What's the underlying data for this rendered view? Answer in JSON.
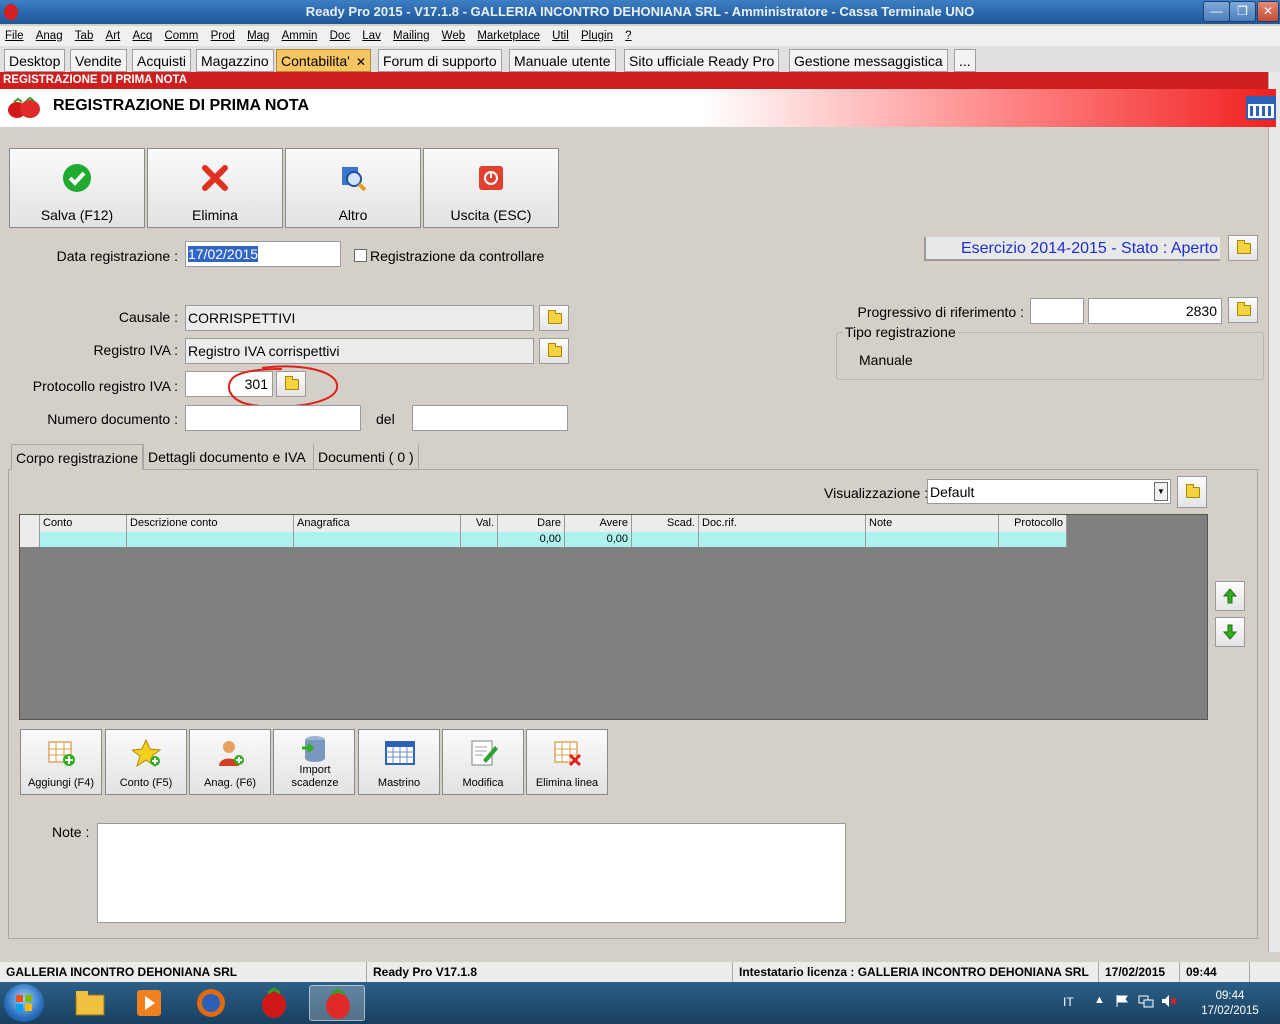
{
  "window": {
    "title": "Ready Pro 2015 - V17.1.8 - GALLERIA INCONTRO DEHONIANA SRL - Amministratore - Cassa Terminale UNO",
    "minimize": "—",
    "restore": "❐",
    "close": "✕"
  },
  "menu": [
    "File",
    "Anag",
    "Tab",
    "Art",
    "Acq",
    "Comm",
    "Prod",
    "Mag",
    "Ammin",
    "Doc",
    "Lav",
    "Mailing",
    "Web",
    "Marketplace",
    "Util",
    "Plugin",
    "?"
  ],
  "tabs": [
    {
      "label": "Desktop"
    },
    {
      "label": "Vendite"
    },
    {
      "label": "Acquisti"
    },
    {
      "label": "Magazzino"
    },
    {
      "label": "Contabilita'",
      "active": true,
      "close": "✕"
    },
    {
      "label": "Forum di supporto"
    },
    {
      "label": "Manuale utente"
    },
    {
      "label": "Sito ufficiale Ready Pro"
    },
    {
      "label": "Gestione messaggistica"
    },
    {
      "label": "..."
    }
  ],
  "form": {
    "caption": "REGISTRAZIONE DI PRIMA NOTA",
    "title": "REGISTRAZIONE DI PRIMA NOTA"
  },
  "toolbar": {
    "save": "Salva (F12)",
    "delete": "Elimina",
    "other": "Altro",
    "exit": "Uscita (ESC)"
  },
  "fields": {
    "data_label": "Data registrazione :",
    "data_value": "17/02/2015",
    "controllare_label": "Registrazione da controllare",
    "esercizio": "Esercizio 2014-2015 - Stato : Aperto",
    "causale_label": "Causale :",
    "causale_value": "CORRISPETTIVI",
    "registro_label": "Registro IVA :",
    "registro_value": "Registro IVA corrispettivi",
    "protocollo_label": "Protocollo registro IVA :",
    "protocollo_value": "301",
    "numero_label": "Numero documento :",
    "numero_value": "",
    "del_label": "del",
    "del_value": "",
    "progressivo_label": "Progressivo di riferimento :",
    "progressivo_a": "",
    "progressivo_b": "2830",
    "tipo_group": "Tipo registrazione",
    "tipo_value": "Manuale"
  },
  "inner_tabs": [
    "Corpo registrazione",
    "Dettagli documento e IVA",
    "Documenti ( 0 )"
  ],
  "view": {
    "label": "Visualizzazione :",
    "value": "Default"
  },
  "grid": {
    "columns": [
      "",
      "Conto",
      "Descrizione conto",
      "Anagrafica",
      "Val.",
      "Dare",
      "Avere",
      "Scad.",
      "Doc.rif.",
      "Note",
      "Protocollo"
    ],
    "rows": [
      [
        "",
        "",
        "",
        "",
        "",
        "0,00",
        "0,00",
        "",
        "",
        "",
        ""
      ]
    ]
  },
  "actions": [
    {
      "label": "Aggiungi (F4)"
    },
    {
      "label": "Conto (F5)"
    },
    {
      "label": "Anag. (F6)"
    },
    {
      "label": "Import scadenze"
    },
    {
      "label": "Mastrino"
    },
    {
      "label": "Modifica"
    },
    {
      "label": "Elimina linea"
    }
  ],
  "note_label": "Note :",
  "note_value": "",
  "status": {
    "company": "GALLERIA INCONTRO DEHONIANA SRL",
    "version": "Ready Pro V17.1.8",
    "license": "Intestatario licenza : GALLERIA INCONTRO DEHONIANA SRL",
    "date": "17/02/2015",
    "time": "09:44"
  },
  "taskbar": {
    "lang": "IT",
    "clock_time": "09:44",
    "clock_date": "17/02/2015"
  },
  "colors": {
    "accent_red": "#ce1e1e",
    "active_tab": "#f6c664",
    "esercizio_blue": "#1a2fd0",
    "grid_row": "#aef2ee"
  }
}
